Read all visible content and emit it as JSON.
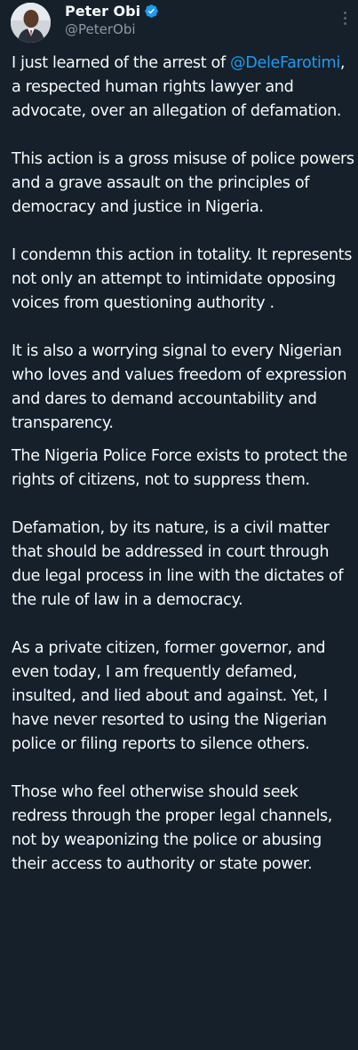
{
  "author": {
    "display_name": "Peter Obi",
    "handle": "@PeterObi",
    "verified": true,
    "avatar": "profile-photo"
  },
  "menu": {
    "icon": "more-vertical-icon"
  },
  "tweet": {
    "p1_before": "I just learned of the arrest of ",
    "p1_mention": "@DeleFarotimi",
    "p1_after": ", a respected human rights lawyer and advocate, over an allegation of defamation.",
    "p2": "This action is a gross misuse of police powers and a grave assault on the principles of democracy and justice in Nigeria.",
    "p3": "I condemn this action in totality. It represents not only an attempt to intimidate opposing voices from questioning authority .",
    "p4": "It is also a worrying signal to every Nigerian who loves and values freedom of expression and dares to demand accountability and transparency.",
    "p5": "The Nigeria Police Force exists to protect the rights of citizens, not to suppress them.",
    "p6": "Defamation, by its nature, is a civil matter that should be addressed in court through due legal process in line with the dictates of the rule of law in a democracy.",
    "p7": "As a private citizen, former governor, and even today, I am frequently defamed, insulted, and lied about and against. Yet, I have never resorted to using the Nigerian police or filing reports to silence others.",
    "p8": "Those who feel otherwise should seek redress through the proper legal channels, not by weaponizing the police or abusing their access to authority or state power."
  },
  "colors": {
    "background": "#15202b",
    "text": "#f7f9f9",
    "secondary": "#8b98a5",
    "link": "#1d9bf0"
  }
}
